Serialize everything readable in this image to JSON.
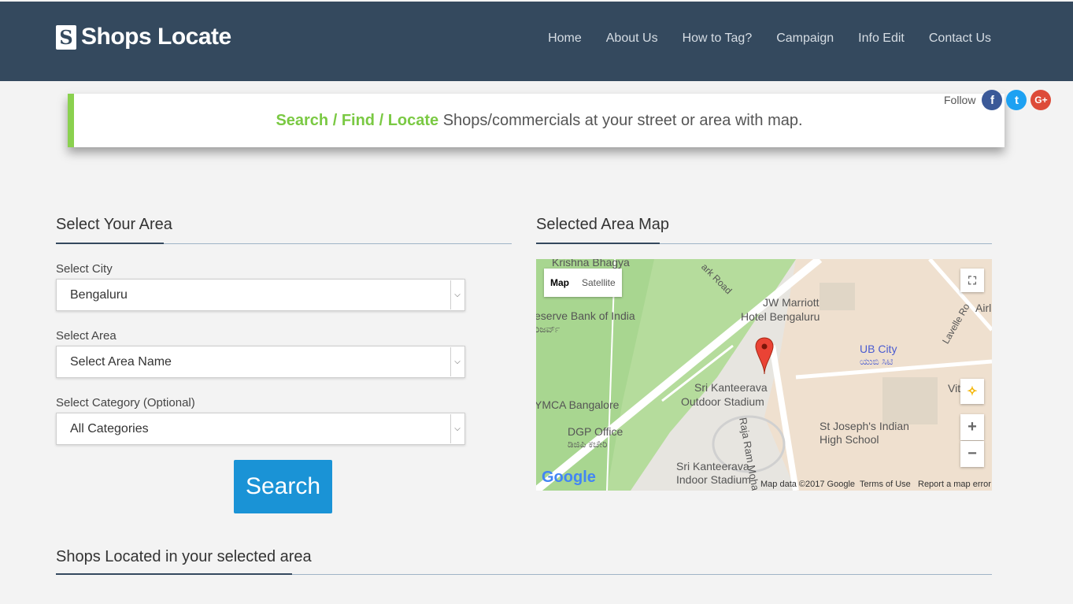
{
  "header": {
    "logo_letter": "S",
    "brand": "Shops Locate",
    "nav": [
      "Home",
      "About Us",
      "How to Tag?",
      "Campaign",
      "Info Edit",
      "Contact Us"
    ]
  },
  "tagline": {
    "highlight": "Search / Find / Locate",
    "rest": " Shops/commercials at your street or area with map."
  },
  "follow": {
    "label": "Follow",
    "icons": [
      "facebook-icon",
      "twitter-icon",
      "google-plus-icon"
    ],
    "glyphs": [
      "f",
      "t",
      "G+"
    ]
  },
  "area_form": {
    "title": "Select Your Area",
    "city_label": "Select City",
    "city_value": "Bengaluru",
    "area_label": "Select Area",
    "area_value": "Select Area Name",
    "category_label": "Select Category (Optional)",
    "category_value": "All Categories",
    "search_label": "Search"
  },
  "map": {
    "title": "Selected Area Map",
    "type_map": "Map",
    "type_satellite": "Satellite",
    "labels": {
      "krishna": "Krishna Bhagya",
      "ark_road": "ark Road",
      "rbi": "eserve Bank of India",
      "rbi_kn": "ರಿಜರ್ವ್",
      "jw": "JW Marriott",
      "jw2": "Hotel Bengaluru",
      "ub": "UB City",
      "ub_kn": "ಯುಬಿ ಸಿಟಿ",
      "lavelle": "Lavelle Ro",
      "air": "Airl",
      "ymca": "YMCA Bangalore",
      "kanteerava": "Sri Kanteerava",
      "outdoor": "Outdoor Stadium",
      "raja": "Raja Ram Mohan Roy",
      "dgp": "DGP Office",
      "dgp_kn": "ಡಿಜಿಪಿ ಕಚೇರಿ",
      "stjoseph": "St Joseph's Indian",
      "stjoseph2": "High School",
      "indoor": "Sri Kanteerava",
      "indoor2": "Indoor Stadium",
      "vit": "Vit"
    },
    "google": "Google",
    "footer_data": "Map data ©2017 Google",
    "footer_terms": "Terms of Use",
    "footer_report": "Report a map error"
  },
  "results": {
    "title": "Shops Located in your selected area"
  },
  "colors": {
    "navbar": "#34495e",
    "accent_green": "#7ac943",
    "button_blue": "#1a93d6"
  }
}
